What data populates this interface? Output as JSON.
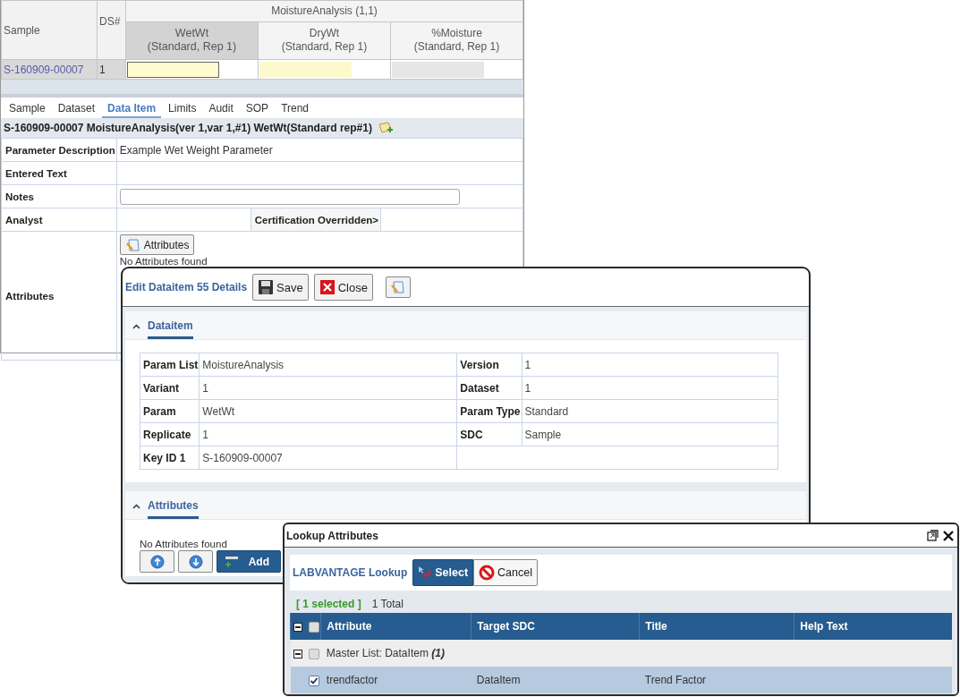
{
  "grid": {
    "sample_header": "Sample",
    "ds_header": "DS#",
    "group_header": "MoistureAnalysis (1,1)",
    "params": [
      {
        "name": "WetWt",
        "sub": "(Standard, Rep 1)",
        "selected": true,
        "disabled": false,
        "focused": true
      },
      {
        "name": "DryWt",
        "sub": "(Standard, Rep 1)",
        "selected": false,
        "disabled": false,
        "focused": false
      },
      {
        "name": "%Moisture",
        "sub": "(Standard, Rep 1)",
        "selected": false,
        "disabled": true,
        "focused": false
      }
    ],
    "row": {
      "sample": "S-160909-00007",
      "ds": "1"
    }
  },
  "tabs": [
    {
      "label": "Sample",
      "selected": false
    },
    {
      "label": "Dataset",
      "selected": false
    },
    {
      "label": "Data Item",
      "selected": true
    },
    {
      "label": "Limits",
      "selected": false
    },
    {
      "label": "Audit",
      "selected": false
    },
    {
      "label": "SOP",
      "selected": false
    },
    {
      "label": "Trend",
      "selected": false
    }
  ],
  "detail_title": "S-160909-00007 MoistureAnalysis(ver 1,var 1,#1) WetWt(Standard rep#1)",
  "details": [
    {
      "label": "Parameter Description",
      "kind": "text",
      "value": "Example Wet Weight Parameter"
    },
    {
      "label": "Entered Text",
      "kind": "text"
    },
    {
      "label": "Notes",
      "kind": "field"
    },
    {
      "label": "Analyst",
      "kind": "split",
      "extra_label": "Certification Overridden>"
    },
    {
      "label": "Attributes",
      "kind": "attributes",
      "button": "Attributes",
      "note": "No Attributes found"
    }
  ],
  "dialog": {
    "title": "Edit Dataitem 55 Details",
    "buttons": [
      {
        "kind": "save",
        "label": "Save"
      },
      {
        "kind": "close",
        "label": "Close"
      },
      {
        "kind": "note"
      }
    ],
    "sections": [
      {
        "title": "Dataitem",
        "expanded": true,
        "kind": "fields",
        "fields": [
          {
            "label": "Param List",
            "value": "MoistureAnalysis"
          },
          {
            "label": "Version",
            "value": "1"
          },
          {
            "label": "Variant",
            "value": "1"
          },
          {
            "label": "Dataset",
            "value": "1"
          },
          {
            "label": "Param",
            "value": "WetWt"
          },
          {
            "label": "Param Type",
            "value": "Standard"
          },
          {
            "label": "Replicate",
            "value": "1"
          },
          {
            "label": "SDC",
            "value": "Sample"
          },
          {
            "label": "Key ID 1",
            "value": "S-160909-00007"
          }
        ]
      },
      {
        "title": "Attributes",
        "expanded": true,
        "kind": "list",
        "note": "No Attributes found",
        "buttons": [
          {
            "kind": "up"
          },
          {
            "kind": "down"
          },
          {
            "kind": "add",
            "label": "Add"
          }
        ]
      }
    ]
  },
  "lookup": {
    "title": "Lookup Attributes",
    "toolbar_label": "LABVANTAGE Lookup",
    "buttons": [
      {
        "kind": "select",
        "label": "Select"
      },
      {
        "kind": "cancel",
        "label": "Cancel"
      }
    ],
    "selected_count": "[ 1 selected ]",
    "total": "1 Total",
    "header_checked": false,
    "columns": [
      "Attribute",
      "Target SDC",
      "Title",
      "Help Text"
    ],
    "group": {
      "label": "Master List: DataItem",
      "count": "(1)",
      "expanded": true,
      "checked": false
    },
    "rows": [
      {
        "attribute": "trendfactor",
        "target_sdc": "DataItem",
        "title": "Trend Factor",
        "checked": true,
        "selected": true
      }
    ]
  }
}
